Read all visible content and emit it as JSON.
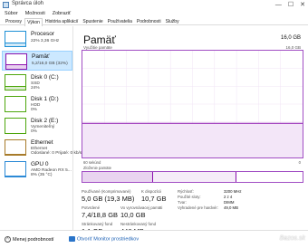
{
  "window": {
    "title": "Správca úloh",
    "controls": [
      "—",
      "☐",
      "✕"
    ]
  },
  "menu": [
    "Súbor",
    "Možnosti",
    "Zobraziť"
  ],
  "tabs": [
    "Procesy",
    "Výkon",
    "História aplikácií",
    "Spustenie",
    "Používatelia",
    "Podrobnosti",
    "Služby"
  ],
  "active_tab": "Výkon",
  "sidebar": [
    {
      "name": "Procesor",
      "line1": "22% 3,36 GHz",
      "line2": "",
      "kind": "cpu",
      "level": 0.22,
      "color": "#1c8fd6"
    },
    {
      "name": "Pamäť",
      "line1": "5,2/16,0 GB (32%)",
      "line2": "",
      "kind": "mem",
      "level": 0.32,
      "color": "#8b12ae"
    },
    {
      "name": "Disk 0 (C:)",
      "line1": "SSD",
      "line2": "24%",
      "kind": "disk",
      "level": 0.24,
      "color": "#4da60c"
    },
    {
      "name": "Disk 1 (D:)",
      "line1": "HDD",
      "line2": "0%",
      "kind": "disk",
      "level": 0.0,
      "color": "#4da60c"
    },
    {
      "name": "Disk 2 (E:)",
      "line1": "Vymeniteľný",
      "line2": "0%",
      "kind": "disk",
      "level": 0.0,
      "color": "#4da60c"
    },
    {
      "name": "Ethernet",
      "line1": "Ethernet",
      "line2": "Odoslané: 0 Prijaté: 0 kb/s",
      "kind": "eth",
      "level": 0.02,
      "color": "#a77b2a"
    },
    {
      "name": "GPU 0",
      "line1": "AMD Radeon RX 5...",
      "line2": "8% (35 °C)",
      "kind": "gpu",
      "level": 0.08,
      "color": "#2c8ad6"
    }
  ],
  "main": {
    "title": "Pamäť",
    "total": "16,0 GB",
    "usage_label": "Využitie pamäte",
    "usage_max": "16,0 GB",
    "time_left": "60 sekúnd",
    "time_right": "0",
    "composition_label": "Zloženie pamäte",
    "usage_fraction": 0.32,
    "composition": [
      {
        "part": "used",
        "fraction": 0.32,
        "color": "#e9d4f0"
      },
      {
        "part": "standby",
        "fraction": 0.38,
        "color": "#f5ecf8"
      },
      {
        "part": "free",
        "fraction": 0.3,
        "color": "#ffffff"
      }
    ],
    "accent": "#8b12ae"
  },
  "stats": {
    "in_use_label": "Používané (Komprimované)",
    "in_use_value": "5,0 GB (19,3 MB)",
    "available_label": "K dispozícii",
    "available_value": "10,7 GB",
    "committed_label": "Potvrdené",
    "committed_value": "7,4/18,8 GB",
    "cached_label": "Vo vyrovnávacej pamäti",
    "cached_value": "10,0 GB",
    "paged_label": "Stránkovaný fond",
    "paged_value": "1,1 GB",
    "nonpaged_label": "Nestránkovaný fond",
    "nonpaged_value": "446 MB"
  },
  "right_stats": [
    {
      "key": "Rýchlosť:",
      "value": "3200 MHz"
    },
    {
      "key": "Použité sloty:",
      "value": "2 z 4"
    },
    {
      "key": "Tvar:",
      "value": "DIMM"
    },
    {
      "key": "Vyhradené pre hardvér:",
      "value": "49,0 MB"
    }
  ],
  "footer": {
    "fewer_details": "Menej podrobností",
    "monitor": "Otvoriť Monitor prostriedkov",
    "watermark": "Bazos.sk"
  }
}
